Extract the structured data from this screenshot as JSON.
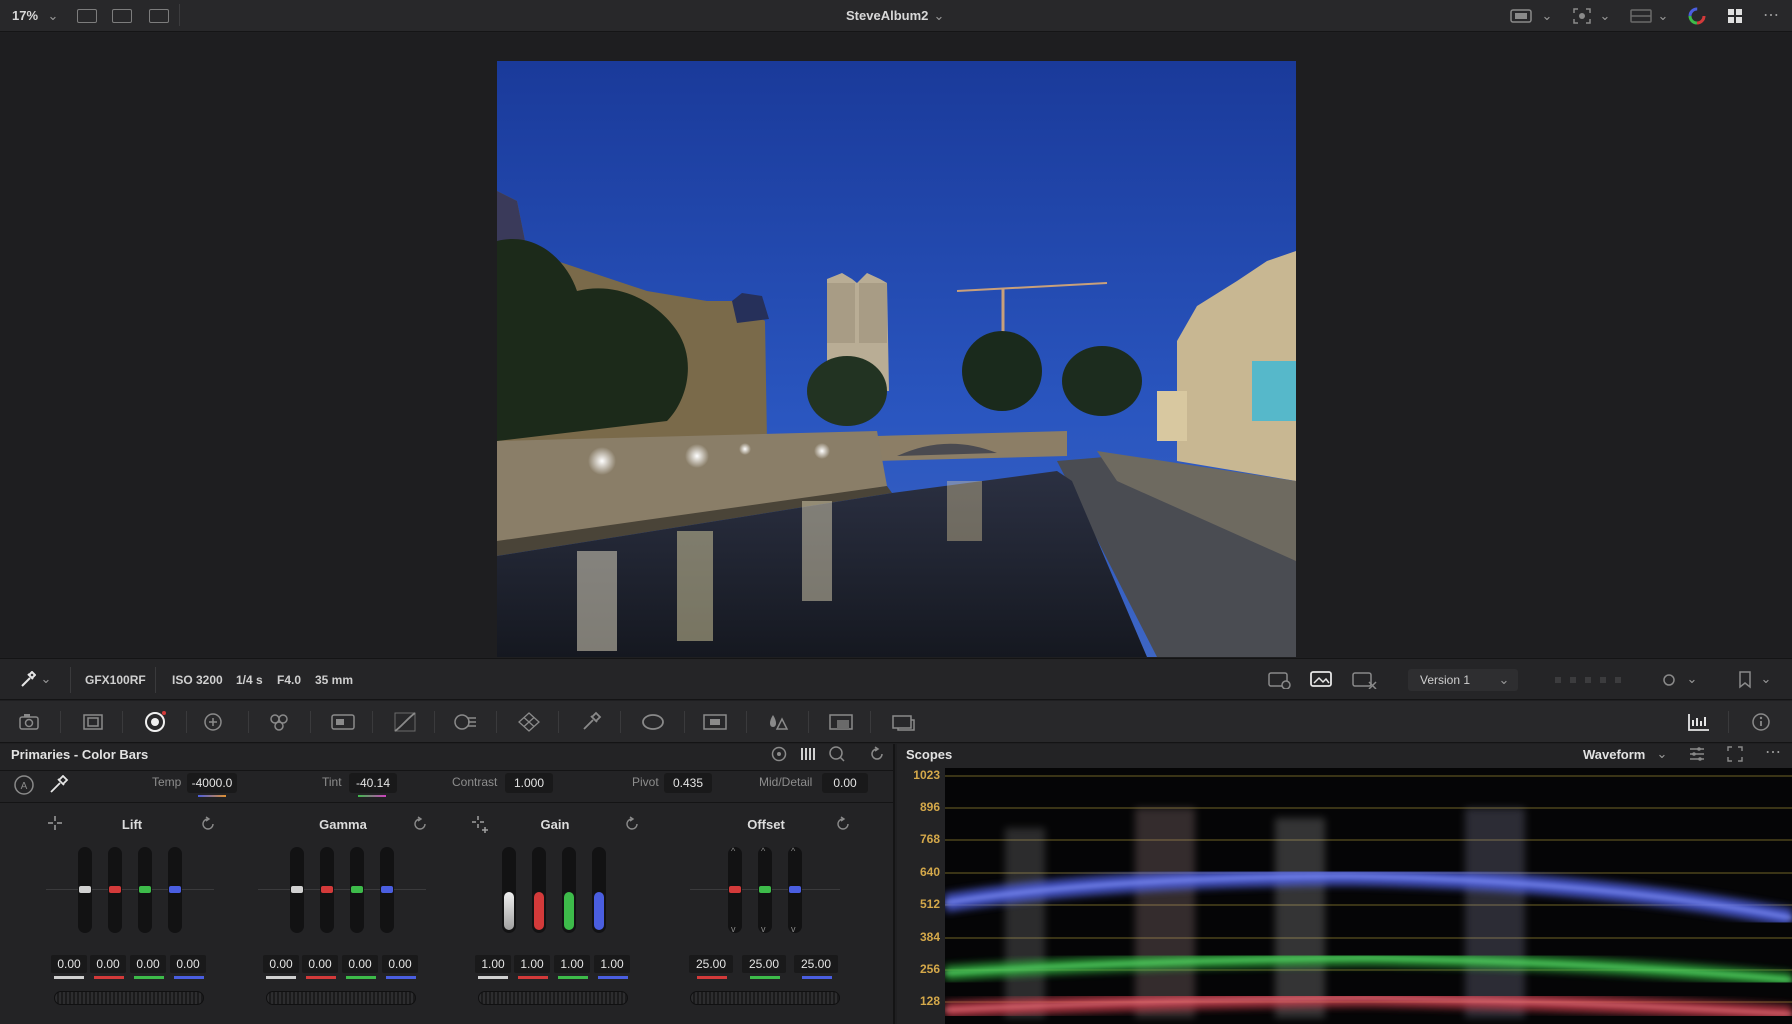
{
  "topbar": {
    "zoom": "17%",
    "album": "SteveAlbum2"
  },
  "clip_info": {
    "camera": "GFX100RF",
    "iso": "ISO 3200",
    "shutter": "1/4 s",
    "aperture": "F4.0",
    "focal": "35 mm",
    "version": "Version 1"
  },
  "primaries": {
    "title": "Primaries - Color Bars",
    "temp_label": "Temp",
    "temp_value": "-4000.0",
    "tint_label": "Tint",
    "tint_value": "-40.14",
    "contrast_label": "Contrast",
    "contrast_value": "1.000",
    "pivot_label": "Pivot",
    "pivot_value": "0.435",
    "middetail_label": "Mid/Detail",
    "middetail_value": "0.00",
    "lift": {
      "title": "Lift",
      "values": [
        "0.00",
        "0.00",
        "0.00",
        "0.00"
      ]
    },
    "gamma": {
      "title": "Gamma",
      "values": [
        "0.00",
        "0.00",
        "0.00",
        "0.00"
      ]
    },
    "gain": {
      "title": "Gain",
      "values": [
        "1.00",
        "1.00",
        "1.00",
        "1.00"
      ]
    },
    "offset": {
      "title": "Offset",
      "values": [
        "25.00",
        "25.00",
        "25.00"
      ]
    }
  },
  "scopes": {
    "title": "Scopes",
    "mode": "Waveform",
    "scale": [
      "1023",
      "896",
      "768",
      "640",
      "512",
      "384",
      "256",
      "128"
    ]
  },
  "colors": {
    "accent_orange": "#d4a84a",
    "red": "#d33a3a",
    "green": "#3dbb4a",
    "blue": "#4a5ee0"
  }
}
